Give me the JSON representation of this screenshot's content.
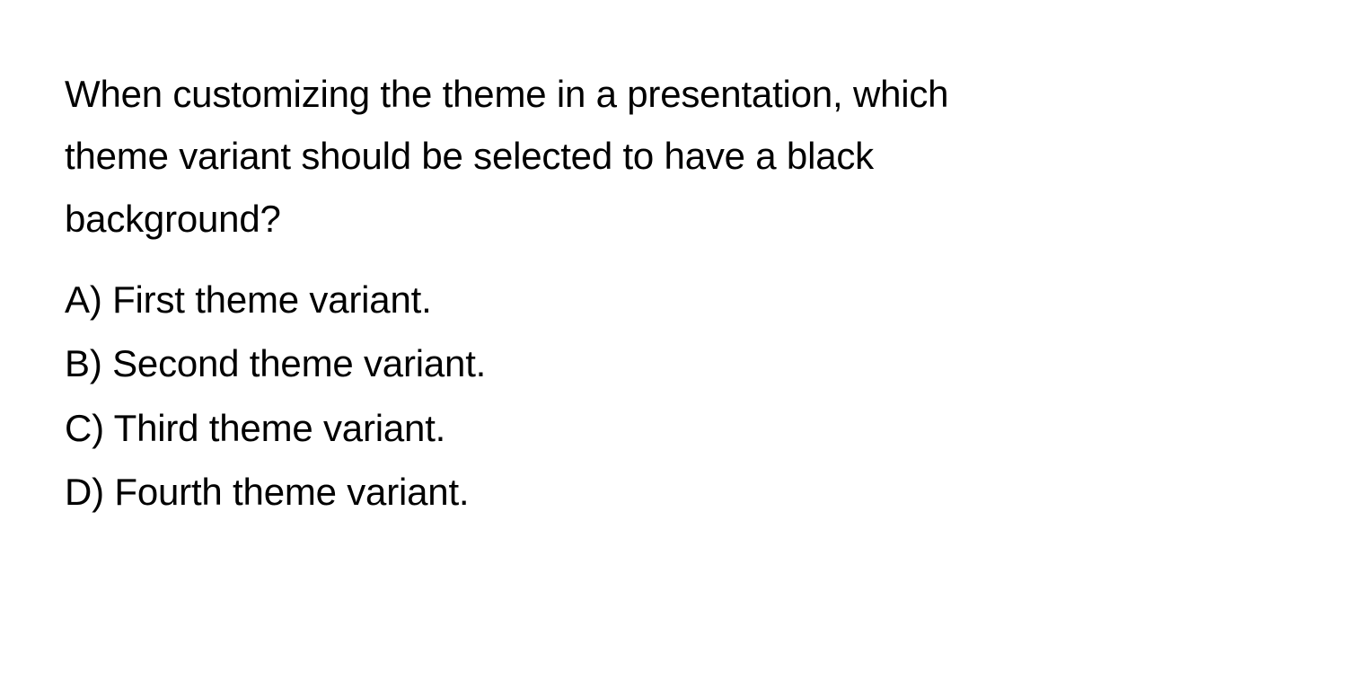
{
  "question": {
    "text": "When customizing the theme in a presentation, which theme variant should be selected to have a black background?",
    "options": [
      {
        "label": "A)",
        "text": "First theme variant."
      },
      {
        "label": "B)",
        "text": "Second theme variant."
      },
      {
        "label": "C)",
        "text": "Third theme variant."
      },
      {
        "label": "D)",
        "text": "Fourth theme variant."
      }
    ]
  }
}
